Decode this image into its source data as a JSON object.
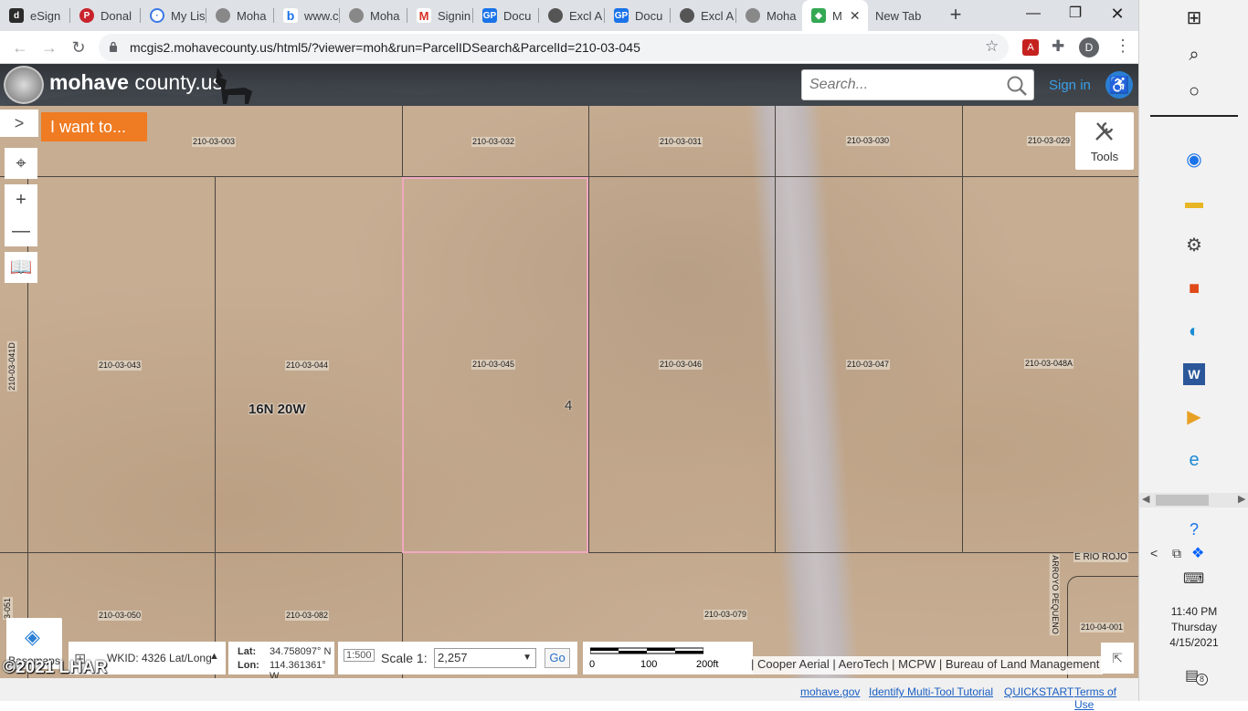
{
  "browser": {
    "tabs": [
      {
        "label": "eSign",
        "icon": "docusign-icon",
        "color": "#2b2b2b"
      },
      {
        "label": "Donal",
        "icon": "pinterest-icon",
        "color": "#c8232c"
      },
      {
        "label": "My Lis",
        "icon": "compass-icon",
        "color": "#3b78e7"
      },
      {
        "label": "Moha",
        "icon": "county-seal-icon",
        "color": "#777777"
      },
      {
        "label": "www.c",
        "icon": "bing-icon",
        "color": "#1a73e8"
      },
      {
        "label": "Moha",
        "icon": "county-seal-icon",
        "color": "#777777"
      },
      {
        "label": "Signin",
        "icon": "gmail-icon",
        "color": "#d93025"
      },
      {
        "label": "Docu",
        "icon": "gp-icon",
        "color": "#1a73e8"
      },
      {
        "label": "Excl A",
        "icon": "globe-icon",
        "color": "#555555"
      },
      {
        "label": "Docu",
        "icon": "gp-icon",
        "color": "#1a73e8"
      },
      {
        "label": "Excl A",
        "icon": "globe-icon",
        "color": "#555555"
      },
      {
        "label": "Moha",
        "icon": "county-seal-icon",
        "color": "#777777"
      },
      {
        "label": "M",
        "icon": "maps-icon",
        "color": "#34a853",
        "active": true
      },
      {
        "label": "New Tab",
        "icon": "",
        "color": ""
      }
    ],
    "url": "mcgis2.mohavecounty.us/html5/?viewer=moh&run=ParcelIDSearch&ParcelId=210-03-045",
    "profile_initial": "D"
  },
  "site": {
    "logo_bold": "mohave",
    "logo_rest": " county.us",
    "search_placeholder": "Search...",
    "signin": "Sign in"
  },
  "map": {
    "i_want_to": "I want to...",
    "tools_label": "Tools",
    "township_label": "16N 20W",
    "section_label": "4",
    "parcels": [
      {
        "id": "210-03-003",
        "name": "parcel-label-210-03-003"
      },
      {
        "id": "210-03-032",
        "name": "parcel-label-210-03-032"
      },
      {
        "id": "210-03-031",
        "name": "parcel-label-210-03-031"
      },
      {
        "id": "210-03-030",
        "name": "parcel-label-210-03-030"
      },
      {
        "id": "210-03-029",
        "name": "parcel-label-210-03-029"
      },
      {
        "id": "210-03-043",
        "name": "parcel-label-210-03-043"
      },
      {
        "id": "210-03-044",
        "name": "parcel-label-210-03-044"
      },
      {
        "id": "210-03-045",
        "name": "parcel-label-210-03-045"
      },
      {
        "id": "210-03-046",
        "name": "parcel-label-210-03-046"
      },
      {
        "id": "210-03-047",
        "name": "parcel-label-210-03-047"
      },
      {
        "id": "210-03-048A",
        "name": "parcel-label-210-03-048a"
      },
      {
        "id": "210-03-050",
        "name": "parcel-label-210-03-050"
      },
      {
        "id": "210-03-082",
        "name": "parcel-label-210-03-082"
      },
      {
        "id": "210-03-079",
        "name": "parcel-label-210-03-079"
      },
      {
        "id": "210-04-001",
        "name": "parcel-label-210-04-001"
      }
    ],
    "side_labels": {
      "left_mid": "210-03-041D",
      "left_bottom": "3-051",
      "street_rio_rojo": "E RIO ROJO",
      "street_arroyo": "ARROYO PEQUENO"
    },
    "basemaps_label": "Basemaps",
    "wkid": "WKID: 4326 Lat/Long",
    "lat_label": "Lat:",
    "lat_value": "34.758097° N",
    "lon_label": "Lon:",
    "lon_value": "114.361361° W",
    "scale_label": "Scale 1:",
    "scale_value": "2,257",
    "go": "Go",
    "scalebar": {
      "t0": "0",
      "t1": "100",
      "t2": "200ft"
    },
    "attribution": "| Cooper Aerial | AeroTech | MCPW | Bureau of Land Management",
    "copyright": "©2021 LHAR"
  },
  "footer": {
    "links": [
      "mohave.gov",
      "Identify Multi-Tool Tutorial",
      "QUICKSTART",
      "Terms of Use"
    ]
  },
  "os": {
    "time": "11:40 PM",
    "day": "Thursday",
    "date": "4/15/2021",
    "notification_count": "8"
  }
}
